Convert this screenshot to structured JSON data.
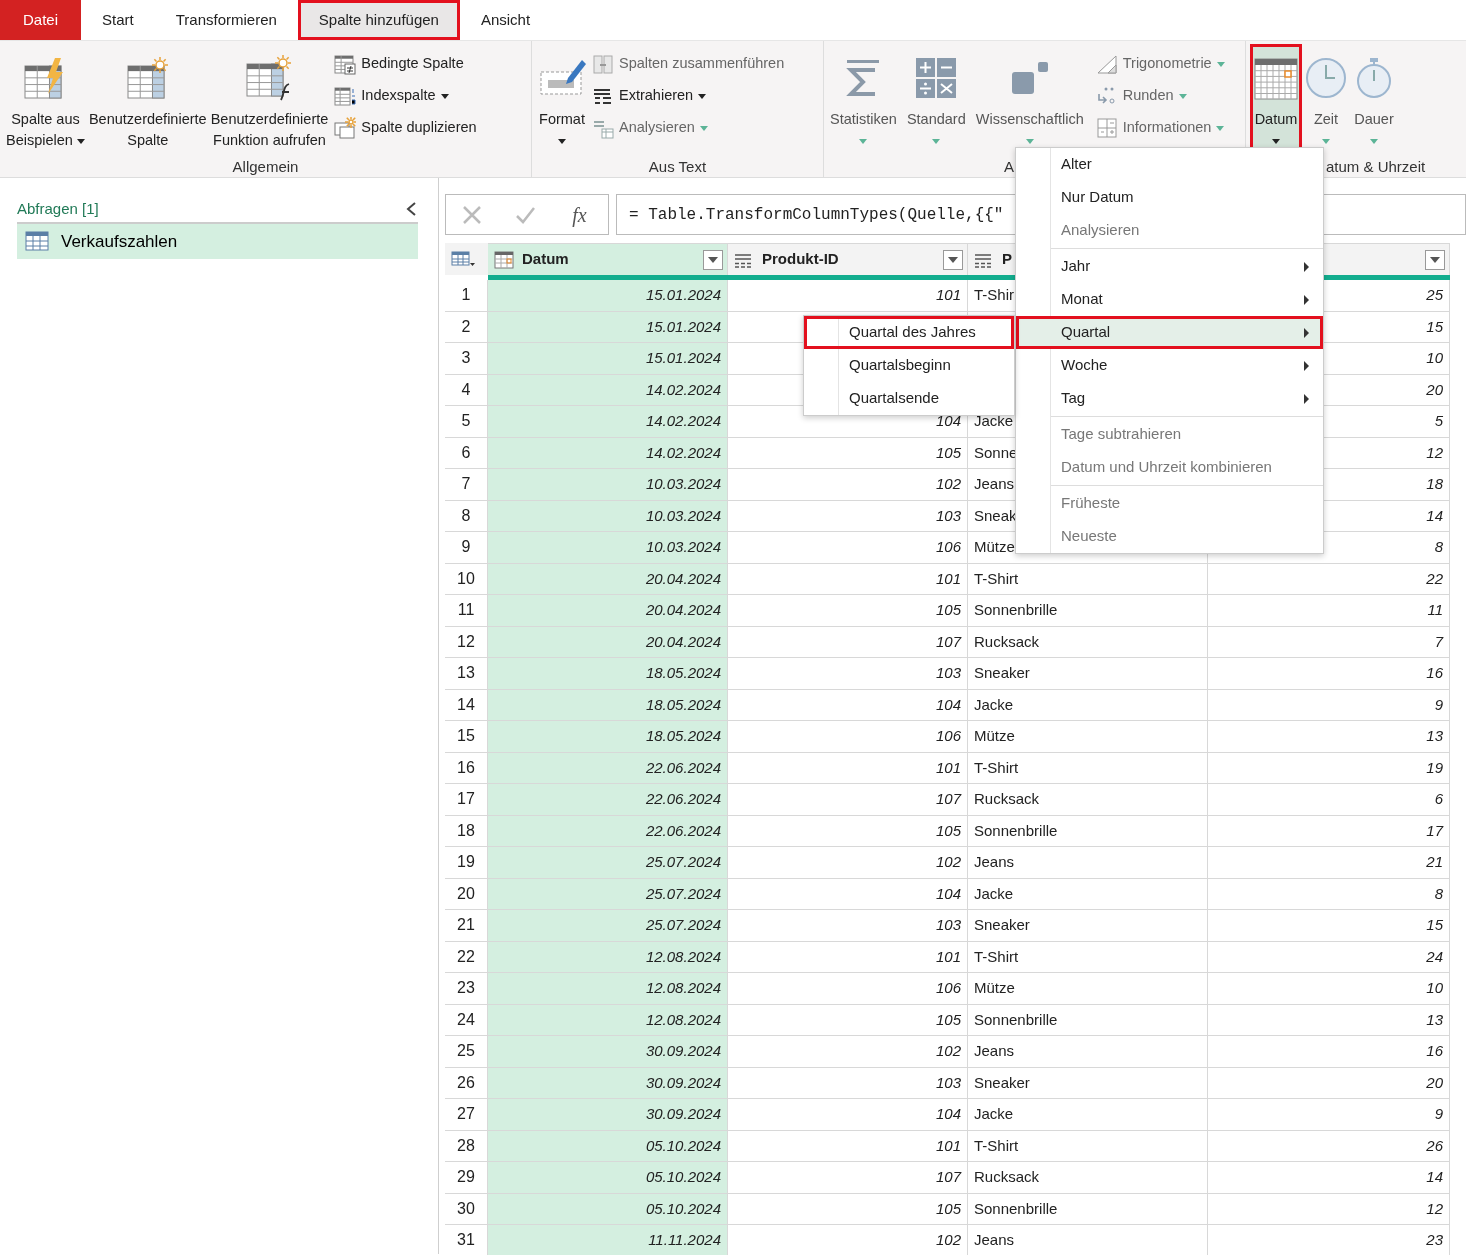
{
  "ribbon_tabs": [
    {
      "label": "Datei",
      "kind": "file",
      "selected": false,
      "highlighted": false
    },
    {
      "label": "Start",
      "kind": "tab",
      "selected": false,
      "highlighted": false
    },
    {
      "label": "Transformieren",
      "kind": "tab",
      "selected": false,
      "highlighted": false
    },
    {
      "label": "Spalte hinzufügen",
      "kind": "tab",
      "selected": true,
      "highlighted": true
    },
    {
      "label": "Ansicht",
      "kind": "tab",
      "selected": false,
      "highlighted": false
    }
  ],
  "ribbon_groups": [
    {
      "label": "Allgemein",
      "large_buttons": [
        {
          "label_lines": [
            "Spalte aus",
            "Beispielen"
          ],
          "kind": "split",
          "disabled": false,
          "pressed": false,
          "highlighted": false
        },
        {
          "label_lines": [
            "Benutzerdefinierte",
            "Spalte"
          ],
          "kind": "plain",
          "disabled": false,
          "pressed": false,
          "highlighted": false
        },
        {
          "label_lines": [
            "Benutzerdefinierte",
            "Funktion aufrufen"
          ],
          "kind": "plain",
          "disabled": false,
          "pressed": false,
          "highlighted": false
        }
      ],
      "small_buttons": [
        {
          "label": "Bedingte Spalte",
          "caret": false,
          "disabled": false
        },
        {
          "label": "Indexspalte",
          "caret": true,
          "disabled": false
        },
        {
          "label": "Spalte duplizieren",
          "caret": false,
          "disabled": false
        }
      ]
    },
    {
      "label": "Aus Text",
      "large_buttons": [
        {
          "label_lines": [
            "Format"
          ],
          "kind": "dropdown",
          "disabled": false,
          "pressed": false,
          "highlighted": false
        }
      ],
      "small_buttons": [
        {
          "label": "Spalten zusammenführen",
          "caret": false,
          "disabled": true
        },
        {
          "label": "Extrahieren",
          "caret": true,
          "disabled": false
        },
        {
          "label": "Analysieren",
          "caret": true,
          "disabled": true
        }
      ]
    },
    {
      "label": "A",
      "large_buttons": [
        {
          "label_lines": [
            "Statistiken"
          ],
          "kind": "dropdown",
          "disabled": true,
          "pressed": false,
          "highlighted": false
        },
        {
          "label_lines": [
            "Standard"
          ],
          "kind": "dropdown",
          "disabled": true,
          "pressed": false,
          "highlighted": false
        },
        {
          "label_lines": [
            "Wissenschaftlich"
          ],
          "kind": "dropdown",
          "disabled": true,
          "pressed": false,
          "highlighted": false
        }
      ],
      "small_buttons": [
        {
          "label": "Trigonometrie",
          "caret": true,
          "disabled": true
        },
        {
          "label": "Runden",
          "caret": true,
          "disabled": true
        },
        {
          "label": "Informationen",
          "caret": true,
          "disabled": true
        }
      ]
    },
    {
      "label": "atum & Uhrzeit",
      "large_buttons": [
        {
          "label_lines": [
            "Datum"
          ],
          "kind": "dropdown",
          "disabled": false,
          "pressed": true,
          "highlighted": true
        },
        {
          "label_lines": [
            "Zeit"
          ],
          "kind": "dropdown",
          "disabled": true,
          "pressed": false,
          "highlighted": false
        },
        {
          "label_lines": [
            "Dauer"
          ],
          "kind": "dropdown",
          "disabled": true,
          "pressed": false,
          "highlighted": false
        }
      ]
    }
  ],
  "queries_pane": {
    "title": "Abfragen [1]",
    "items": [
      {
        "label": "Verkaufszahlen",
        "selected": true
      }
    ]
  },
  "formula_bar": {
    "fx_button": "fx",
    "formula": "= Table.TransformColumnTypes(Quelle,{{\""
  },
  "table": {
    "columns": [
      {
        "label": "Datum",
        "kind": "date",
        "selected": true
      },
      {
        "label": "Produkt-ID",
        "kind": "any-number",
        "selected": false
      },
      {
        "label": "P",
        "kind": "any-text",
        "selected": false
      },
      {
        "kind": "any-number",
        "selected": false
      }
    ],
    "rows": [
      {
        "row_number": "1",
        "datum": "15.01.2024",
        "produkt_id": "101",
        "column_3": "T-Shir",
        "column_4": "25"
      },
      {
        "row_number": "2",
        "datum": "15.01.2024",
        "column_4": "15"
      },
      {
        "row_number": "3",
        "datum": "15.01.2024",
        "column_4": "10"
      },
      {
        "row_number": "4",
        "datum": "14.02.2024",
        "column_4": "20"
      },
      {
        "row_number": "5",
        "datum": "14.02.2024",
        "produkt_id": "104",
        "column_3": "Jacke",
        "column_4": "5"
      },
      {
        "row_number": "6",
        "datum": "14.02.2024",
        "produkt_id": "105",
        "column_3": "Sonne",
        "column_4": "12"
      },
      {
        "row_number": "7",
        "datum": "10.03.2024",
        "produkt_id": "102",
        "column_3": "Jeans",
        "column_4": "18"
      },
      {
        "row_number": "8",
        "datum": "10.03.2024",
        "produkt_id": "103",
        "column_3": "Sneak",
        "column_4": "14"
      },
      {
        "row_number": "9",
        "datum": "10.03.2024",
        "produkt_id": "106",
        "column_3": "Mütze",
        "column_4": "8"
      },
      {
        "row_number": "10",
        "datum": "20.04.2024",
        "produkt_id": "101",
        "column_3": "T-Shirt",
        "column_4": "22"
      },
      {
        "row_number": "11",
        "datum": "20.04.2024",
        "produkt_id": "105",
        "column_3": "Sonnenbrille",
        "column_4": "11"
      },
      {
        "row_number": "12",
        "datum": "20.04.2024",
        "produkt_id": "107",
        "column_3": "Rucksack",
        "column_4": "7"
      },
      {
        "row_number": "13",
        "datum": "18.05.2024",
        "produkt_id": "103",
        "column_3": "Sneaker",
        "column_4": "16"
      },
      {
        "row_number": "14",
        "datum": "18.05.2024",
        "produkt_id": "104",
        "column_3": "Jacke",
        "column_4": "9"
      },
      {
        "row_number": "15",
        "datum": "18.05.2024",
        "produkt_id": "106",
        "column_3": "Mütze",
        "column_4": "13"
      },
      {
        "row_number": "16",
        "datum": "22.06.2024",
        "produkt_id": "101",
        "column_3": "T-Shirt",
        "column_4": "19"
      },
      {
        "row_number": "17",
        "datum": "22.06.2024",
        "produkt_id": "107",
        "column_3": "Rucksack",
        "column_4": "6"
      },
      {
        "row_number": "18",
        "datum": "22.06.2024",
        "produkt_id": "105",
        "column_3": "Sonnenbrille",
        "column_4": "17"
      },
      {
        "row_number": "19",
        "datum": "25.07.2024",
        "produkt_id": "102",
        "column_3": "Jeans",
        "column_4": "21"
      },
      {
        "row_number": "20",
        "datum": "25.07.2024",
        "produkt_id": "104",
        "column_3": "Jacke",
        "column_4": "8"
      },
      {
        "row_number": "21",
        "datum": "25.07.2024",
        "produkt_id": "103",
        "column_3": "Sneaker",
        "column_4": "15"
      },
      {
        "row_number": "22",
        "datum": "12.08.2024",
        "produkt_id": "101",
        "column_3": "T-Shirt",
        "column_4": "24"
      },
      {
        "row_number": "23",
        "datum": "12.08.2024",
        "produkt_id": "106",
        "column_3": "Mütze",
        "column_4": "10"
      },
      {
        "row_number": "24",
        "datum": "12.08.2024",
        "produkt_id": "105",
        "column_3": "Sonnenbrille",
        "column_4": "13"
      },
      {
        "row_number": "25",
        "datum": "30.09.2024",
        "produkt_id": "102",
        "column_3": "Jeans",
        "column_4": "16"
      },
      {
        "row_number": "26",
        "datum": "30.09.2024",
        "produkt_id": "103",
        "column_3": "Sneaker",
        "column_4": "20"
      },
      {
        "row_number": "27",
        "datum": "30.09.2024",
        "produkt_id": "104",
        "column_3": "Jacke",
        "column_4": "9"
      },
      {
        "row_number": "28",
        "datum": "05.10.2024",
        "produkt_id": "101",
        "column_3": "T-Shirt",
        "column_4": "26"
      },
      {
        "row_number": "29",
        "datum": "05.10.2024",
        "produkt_id": "107",
        "column_3": "Rucksack",
        "column_4": "14"
      },
      {
        "row_number": "30",
        "datum": "05.10.2024",
        "produkt_id": "105",
        "column_3": "Sonnenbrille",
        "column_4": "12"
      },
      {
        "row_number": "31",
        "datum": "11.11.2024",
        "produkt_id": "102",
        "column_3": "Jeans",
        "column_4": "23"
      }
    ]
  },
  "date_menu": {
    "items": [
      {
        "kind": "item",
        "label": "Alter",
        "disabled": false,
        "submenu": false,
        "selected": false,
        "highlighted": false
      },
      {
        "kind": "item",
        "label": "Nur Datum",
        "disabled": false,
        "submenu": false,
        "selected": false,
        "highlighted": false
      },
      {
        "kind": "item",
        "label": "Analysieren",
        "disabled": true,
        "submenu": false,
        "selected": false,
        "highlighted": false
      },
      {
        "kind": "separator"
      },
      {
        "kind": "item",
        "label": "Jahr",
        "disabled": false,
        "submenu": true,
        "selected": false,
        "highlighted": false
      },
      {
        "kind": "item",
        "label": "Monat",
        "disabled": false,
        "submenu": true,
        "selected": false,
        "highlighted": false
      },
      {
        "kind": "item",
        "label": "Quartal",
        "disabled": false,
        "submenu": true,
        "selected": true,
        "highlighted": true
      },
      {
        "kind": "item",
        "label": "Woche",
        "disabled": false,
        "submenu": true,
        "selected": false,
        "highlighted": false
      },
      {
        "kind": "item",
        "label": "Tag",
        "disabled": false,
        "submenu": true,
        "selected": false,
        "highlighted": false
      },
      {
        "kind": "separator"
      },
      {
        "kind": "item",
        "label": "Tage subtrahieren",
        "disabled": true,
        "submenu": false,
        "selected": false,
        "highlighted": false
      },
      {
        "kind": "item",
        "label": "Datum und Uhrzeit kombinieren",
        "disabled": true,
        "submenu": false,
        "selected": false,
        "highlighted": false
      },
      {
        "kind": "separator"
      },
      {
        "kind": "item",
        "label": "Früheste",
        "disabled": true,
        "submenu": false,
        "selected": false,
        "highlighted": false
      },
      {
        "kind": "item",
        "label": "Neueste",
        "disabled": true,
        "submenu": false,
        "selected": false,
        "highlighted": false
      }
    ]
  },
  "quarter_submenu": {
    "items": [
      {
        "kind": "item",
        "label": "Quartal des Jahres",
        "disabled": false,
        "submenu": false,
        "selected": false,
        "highlighted": true
      },
      {
        "kind": "item",
        "label": "Quartalsbeginn",
        "disabled": false,
        "submenu": false,
        "selected": false,
        "highlighted": false
      },
      {
        "kind": "item",
        "label": "Quartalsende",
        "disabled": false,
        "submenu": false,
        "selected": false,
        "highlighted": false
      }
    ]
  }
}
